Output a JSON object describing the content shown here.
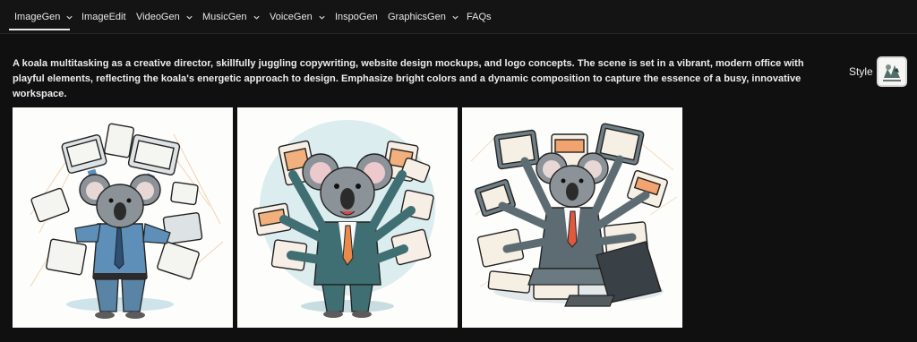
{
  "nav": {
    "tabs": [
      {
        "label": "ImageGen",
        "has_dropdown": true,
        "active": true
      },
      {
        "label": "ImageEdit",
        "has_dropdown": false,
        "active": false
      },
      {
        "label": "VideoGen",
        "has_dropdown": true,
        "active": false
      },
      {
        "label": "MusicGen",
        "has_dropdown": true,
        "active": false
      },
      {
        "label": "VoiceGen",
        "has_dropdown": true,
        "active": false
      },
      {
        "label": "InspoGen",
        "has_dropdown": false,
        "active": false
      },
      {
        "label": "GraphicsGen",
        "has_dropdown": true,
        "active": false
      },
      {
        "label": "FAQs",
        "has_dropdown": false,
        "active": false
      }
    ]
  },
  "prompt": {
    "text": "A koala multitasking as a creative director, skillfully juggling copywriting, website design mockups, and logo concepts. The scene is set in a vibrant, modern office with playful elements, reflecting the koala's energetic approach to design. Emphasize bright colors and a dynamic composition to capture the essence of a busy, innovative workspace."
  },
  "style": {
    "label": "Style"
  },
  "colors": {
    "background": "#101010",
    "nav_text": "#e6e6e6",
    "accent_orange": "#e9894a",
    "koala_grey": "#8c9398",
    "suit_teal": "#3f6e73",
    "shirt_blue": "#5d8fb8"
  },
  "results": [
    {
      "icon": "koala-blue-shirt-image"
    },
    {
      "icon": "koala-teal-suit-image"
    },
    {
      "icon": "koala-laptop-image"
    }
  ]
}
